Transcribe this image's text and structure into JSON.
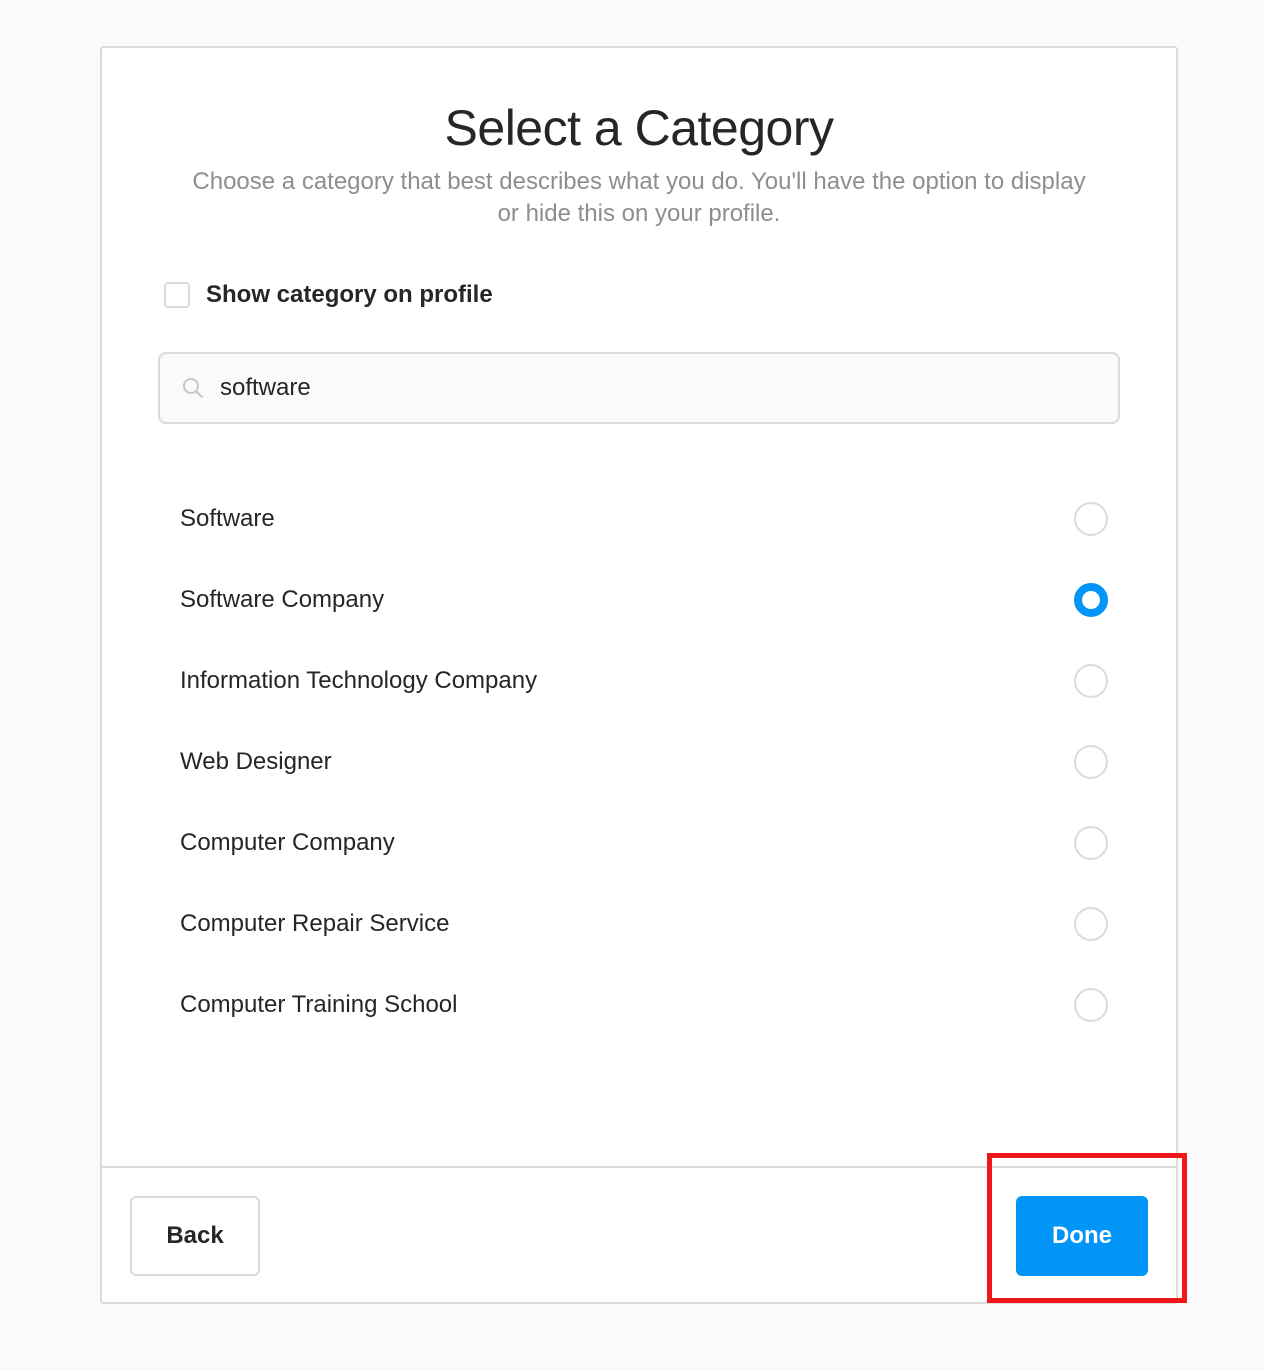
{
  "dialog": {
    "title": "Select a Category",
    "subtitle": "Choose a category that best describes what you do. You'll have the option to display or hide this on your profile.",
    "show_category": {
      "label": "Show category on profile",
      "checked": false
    },
    "search": {
      "value": "software",
      "icon": "search-icon"
    },
    "categories": [
      {
        "label": "Software",
        "selected": false
      },
      {
        "label": "Software Company",
        "selected": true
      },
      {
        "label": "Information Technology Company",
        "selected": false
      },
      {
        "label": "Web Designer",
        "selected": false
      },
      {
        "label": "Computer Company",
        "selected": false
      },
      {
        "label": "Computer Repair Service",
        "selected": false
      },
      {
        "label": "Computer Training School",
        "selected": false
      }
    ],
    "footer": {
      "back_label": "Back",
      "done_label": "Done"
    }
  },
  "colors": {
    "accent": "#0095f6",
    "highlight": "#f0161c",
    "border": "#dbdbdb",
    "subtitle": "#8e8e8e"
  }
}
